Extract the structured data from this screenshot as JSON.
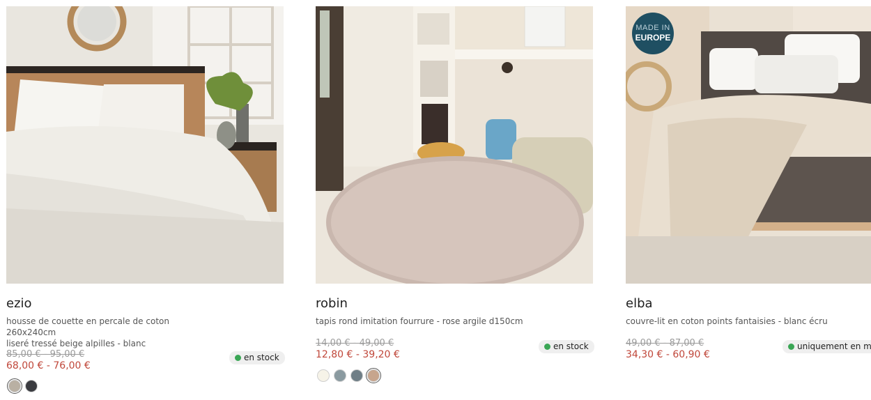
{
  "products": [
    {
      "name": "ezio",
      "description_line1": "housse de couette en percale de coton 260x240cm",
      "description_line2": "liseré tressé beige alpilles - blanc",
      "old_price": "85,00 € - 95,00 €",
      "new_price": "68,00 € - 76,00 €",
      "stock": "en stock",
      "swatches": [
        "#b9b0a3",
        "#3a3b40"
      ],
      "selected_swatch": 0
    },
    {
      "name": "robin",
      "description_line1": "tapis rond imitation fourrure - rose argile d150cm",
      "old_price": "14,00 € - 49,00 €",
      "new_price": "12,80 € - 39,20 €",
      "stock": "en stock",
      "swatches": [
        "#f6f3e8",
        "#8a9aa0",
        "#6f7e86",
        "#c7a58d"
      ],
      "selected_swatch": 3
    },
    {
      "name": "elba",
      "description_line1": "couvre-lit en coton points fantaisies - blanc écru",
      "old_price": "49,00 € - 87,00 €",
      "new_price": "34,30 € - 60,90 €",
      "stock": "uniquement en m",
      "badge_line1": "MADE IN",
      "badge_line2": "EUROPE"
    }
  ],
  "colors": {
    "sale": "#c0473a",
    "stock_dot": "#3aa655",
    "badge": "#1f4f62"
  }
}
